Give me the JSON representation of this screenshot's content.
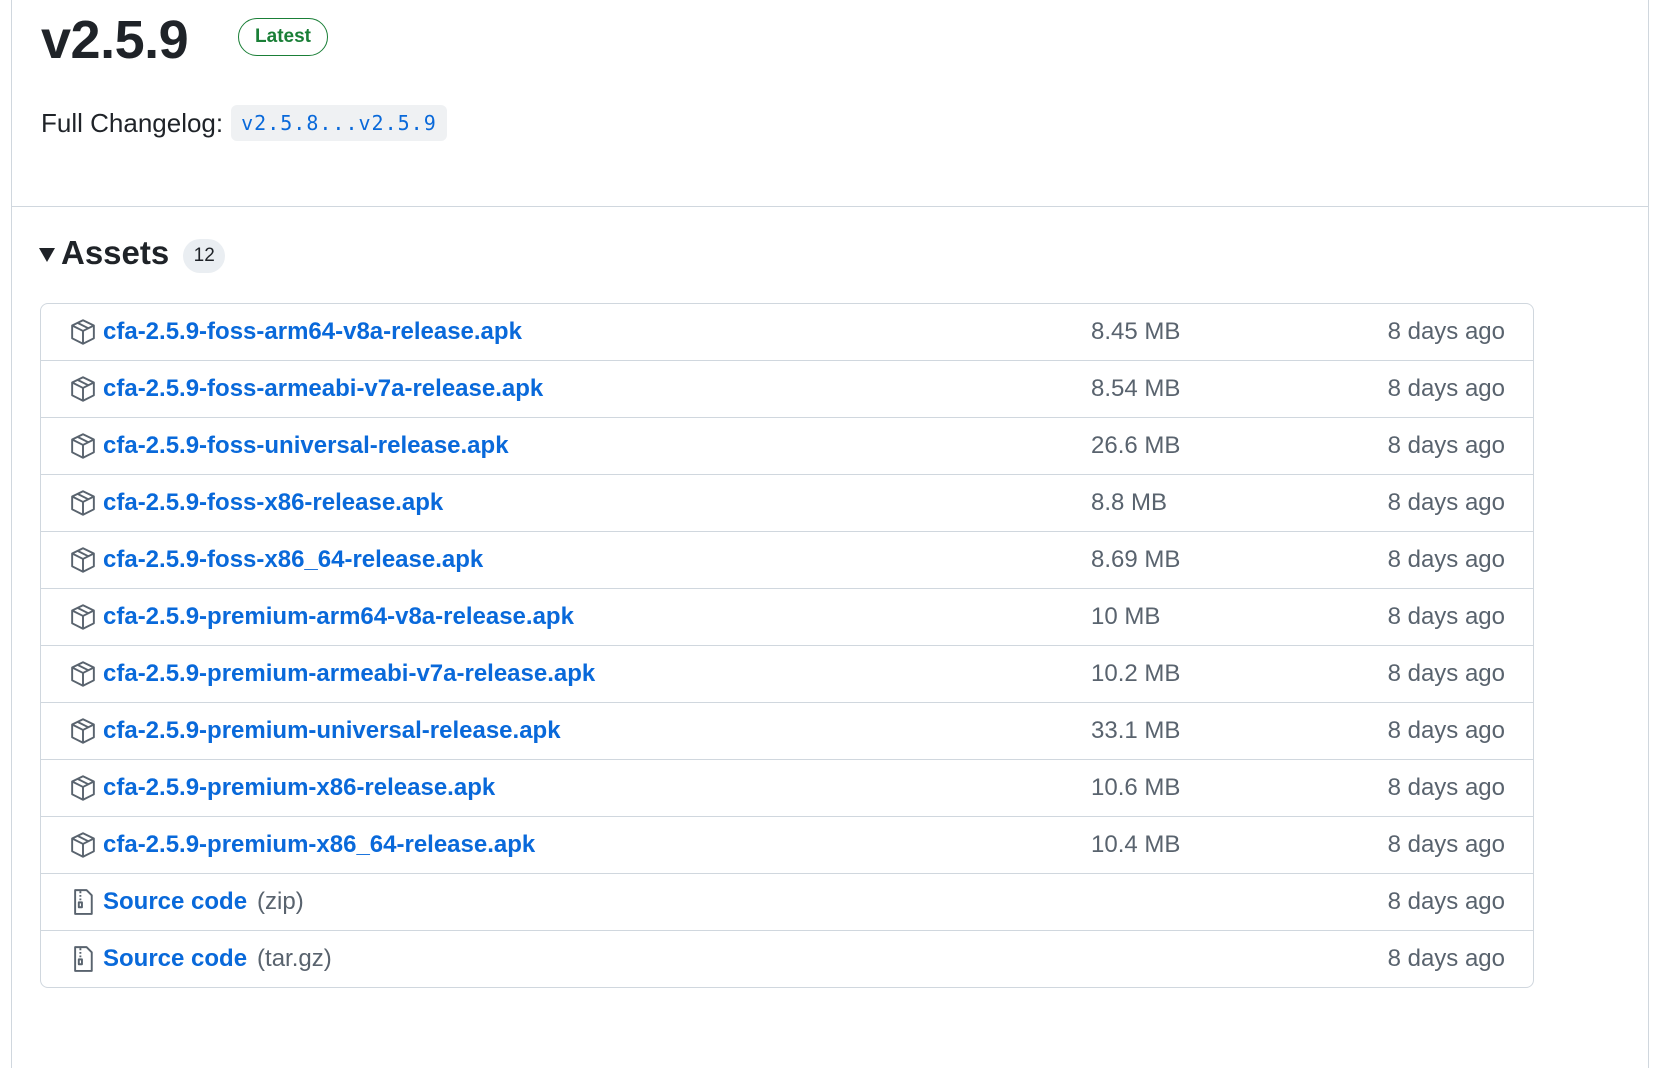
{
  "release": {
    "version": "v2.5.9",
    "badge": "Latest",
    "changelog_label": "Full Changelog:",
    "compare_range": "v2.5.8...v2.5.9"
  },
  "assets": {
    "title": "Assets",
    "count": "12",
    "items": [
      {
        "name": "cfa-2.5.9-foss-arm64-v8a-release.apk",
        "suffix": "",
        "size": "8.45 MB",
        "date": "8 days ago",
        "icon": "package-icon"
      },
      {
        "name": "cfa-2.5.9-foss-armeabi-v7a-release.apk",
        "suffix": "",
        "size": "8.54 MB",
        "date": "8 days ago",
        "icon": "package-icon"
      },
      {
        "name": "cfa-2.5.9-foss-universal-release.apk",
        "suffix": "",
        "size": "26.6 MB",
        "date": "8 days ago",
        "icon": "package-icon"
      },
      {
        "name": "cfa-2.5.9-foss-x86-release.apk",
        "suffix": "",
        "size": "8.8 MB",
        "date": "8 days ago",
        "icon": "package-icon"
      },
      {
        "name": "cfa-2.5.9-foss-x86_64-release.apk",
        "suffix": "",
        "size": "8.69 MB",
        "date": "8 days ago",
        "icon": "package-icon"
      },
      {
        "name": "cfa-2.5.9-premium-arm64-v8a-release.apk",
        "suffix": "",
        "size": "10 MB",
        "date": "8 days ago",
        "icon": "package-icon"
      },
      {
        "name": "cfa-2.5.9-premium-armeabi-v7a-release.apk",
        "suffix": "",
        "size": "10.2 MB",
        "date": "8 days ago",
        "icon": "package-icon"
      },
      {
        "name": "cfa-2.5.9-premium-universal-release.apk",
        "suffix": "",
        "size": "33.1 MB",
        "date": "8 days ago",
        "icon": "package-icon"
      },
      {
        "name": "cfa-2.5.9-premium-x86-release.apk",
        "suffix": "",
        "size": "10.6 MB",
        "date": "8 days ago",
        "icon": "package-icon"
      },
      {
        "name": "cfa-2.5.9-premium-x86_64-release.apk",
        "suffix": "",
        "size": "10.4 MB",
        "date": "8 days ago",
        "icon": "package-icon"
      },
      {
        "name": "Source code",
        "suffix": "(zip)",
        "size": "",
        "date": "8 days ago",
        "icon": "file-zip-icon"
      },
      {
        "name": "Source code",
        "suffix": "(tar.gz)",
        "size": "",
        "date": "8 days ago",
        "icon": "file-zip-icon"
      }
    ]
  },
  "colors": {
    "link": "#0969da",
    "muted": "#59636e",
    "border": "#d0d7de",
    "badge_green": "#1a7f37"
  }
}
